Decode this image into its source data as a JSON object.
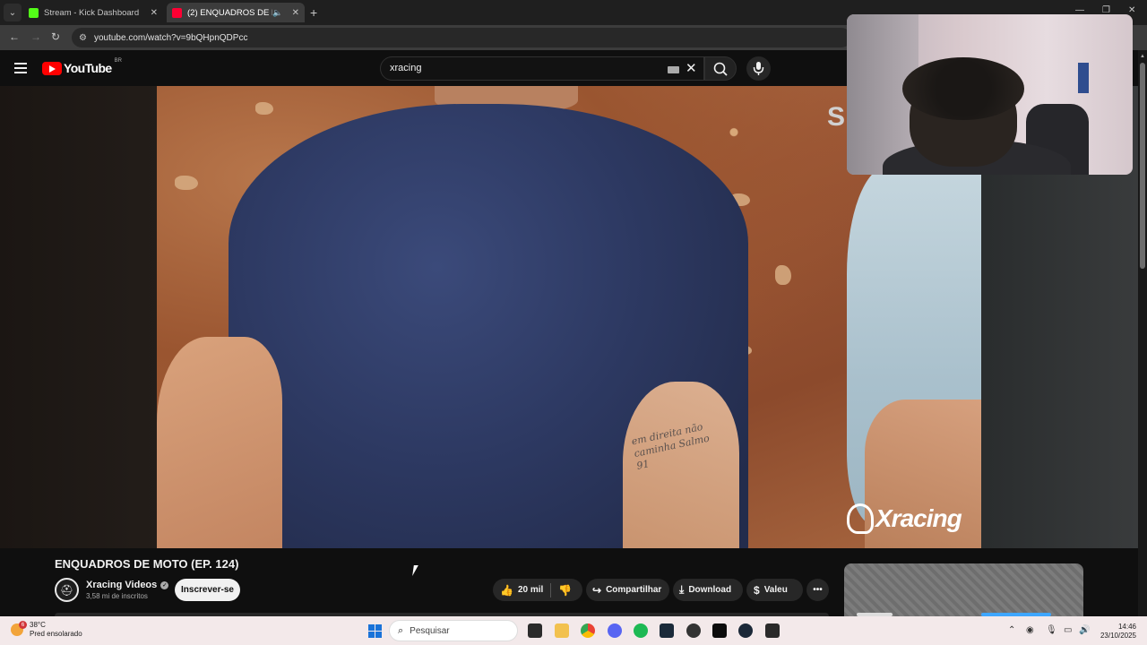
{
  "browser": {
    "tabs": [
      {
        "title": "Stream - Kick Dashboard",
        "favicon_color": "#53fc18",
        "active": false
      },
      {
        "title": "(2) ENQUADROS DE MOTO",
        "favicon_color": "#ff0033",
        "active": true
      }
    ],
    "url": "youtube.com/watch?v=9bQHpnQDPcc"
  },
  "youtube": {
    "logo_text": "YouTube",
    "country_code": "BR",
    "search_query": "xracing"
  },
  "video": {
    "overlay_letter": "S",
    "watermark": "Xracing",
    "tattoo_text": "em direita não caminha Salmo 91"
  },
  "info": {
    "title": "ENQUADROS DE MOTO (EP. 124)",
    "channel_name": "Xracing Videos",
    "subscribers": "3,58 mi de inscritos",
    "subscribe_label": "Inscrever-se",
    "likes": "20 mil",
    "share_label": "Compartilhar",
    "download_label": "Download",
    "thanks_label": "Valeu"
  },
  "taskbar": {
    "weather_temp": "38°C",
    "weather_desc": "Pred ensolarado",
    "notification_count": "6",
    "search_label": "Pesquisar",
    "time": "14:46",
    "date": "23/10/2025"
  },
  "colors": {
    "youtube_red": "#ff0000",
    "subscribe_bg": "#f1f1f1",
    "taskbar_bg": "#f3e9ea",
    "windows_blue": "#1a73d9"
  }
}
